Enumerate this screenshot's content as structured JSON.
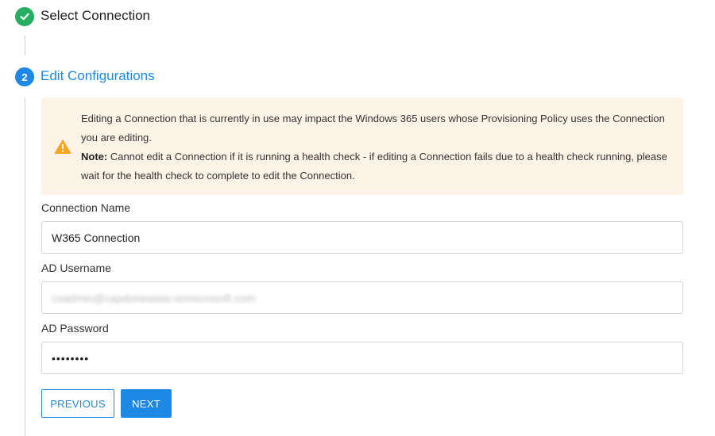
{
  "steps": [
    {
      "number": "",
      "title": "Select Connection",
      "status": "complete",
      "icon": "check-icon"
    },
    {
      "number": "2",
      "title": "Edit Configurations",
      "status": "active"
    }
  ],
  "warning": {
    "icon": "warning-icon",
    "text_line1": "Editing a Connection that is currently in use may impact the Windows 365 users whose Provisioning Policy uses the Connection you are editing.",
    "note_label": "Note:",
    "note_text": " Cannot edit a Connection if it is running a health check - if editing a Connection fails due to a health check running, please wait for the health check to complete to edit the Connection."
  },
  "form": {
    "connection_name": {
      "label": "Connection Name",
      "value": "W365 Connection"
    },
    "ad_username": {
      "label": "AD Username",
      "value": "csadmin@capdonewww.onmicrosoft.com"
    },
    "ad_password": {
      "label": "AD Password",
      "value": "••••••••"
    }
  },
  "buttons": {
    "previous": "PREVIOUS",
    "next": "NEXT"
  },
  "colors": {
    "primary": "#1e88e5",
    "success": "#27ae60",
    "warning_bg": "#fdf3e7",
    "warning_icon": "#f5a623"
  }
}
